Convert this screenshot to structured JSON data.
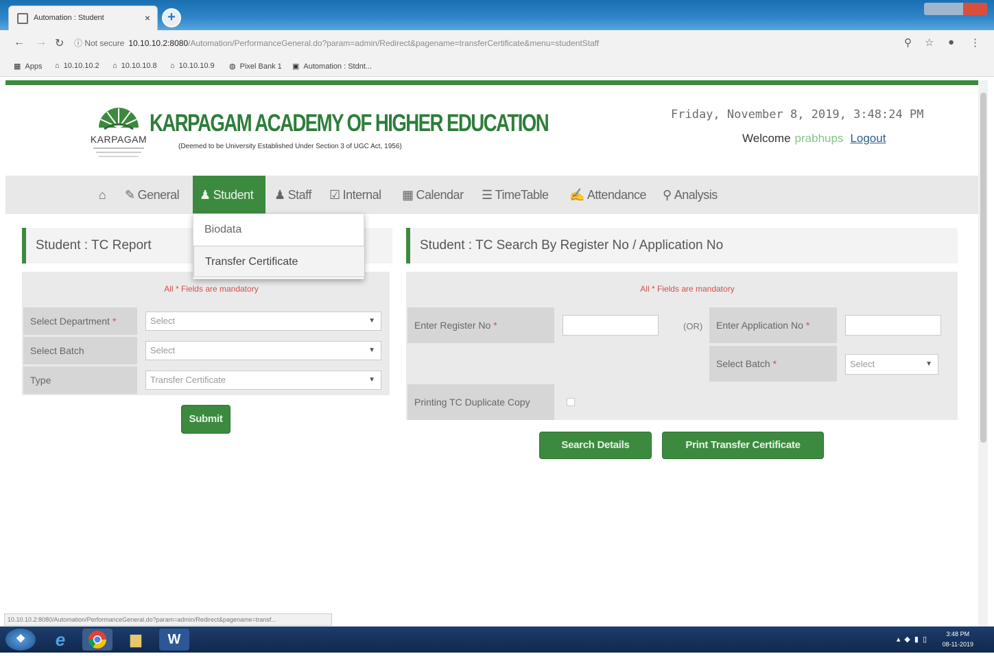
{
  "browser": {
    "tab_title": "Automation : Student",
    "tab_close": "×",
    "new_tab": "+",
    "not_secure": "ⓘ Not secure",
    "url_host": "10.10.10.2:8080",
    "url_path": "/Automation/PerformanceGeneral.do?param=admin/Redirect&pagename=transferCertificate&menu=studentStaff",
    "bookmarks": [
      {
        "icon": "apps-icon",
        "label": "Apps"
      },
      {
        "icon": "home-icon",
        "label": "10.10.10.2"
      },
      {
        "icon": "home-icon",
        "label": "10.10.10.8"
      },
      {
        "icon": "home-icon",
        "label": "10.10.10.9"
      },
      {
        "icon": "globe-icon",
        "label": "Pixel Bank 1"
      },
      {
        "icon": "page-icon",
        "label": "Automation : Stdnt..."
      }
    ]
  },
  "header": {
    "brand": "KARPAGAM ACADEMY OF HIGHER EDUCATION",
    "brand_sub": "(Deemed to be University Established Under Section 3 of UGC Act, 1956)",
    "logo_text": "KARPAGAM",
    "datetime": "Friday, November 8, 2019, 3:48:24 PM",
    "welcome": "Welcome",
    "username": "prabhups",
    "logout": "Logout"
  },
  "nav": {
    "items": [
      {
        "icon": "⌂",
        "label": ""
      },
      {
        "icon": "✎",
        "label": "General"
      },
      {
        "icon": "👤",
        "label": "Student"
      },
      {
        "icon": "♟",
        "label": "Staff"
      },
      {
        "icon": "☑",
        "label": "Internal"
      },
      {
        "icon": "▦",
        "label": "Calendar"
      },
      {
        "icon": "☰",
        "label": "TimeTable"
      },
      {
        "icon": "✍",
        "label": "Attendance"
      },
      {
        "icon": "⚲",
        "label": "Analysis"
      }
    ],
    "dropdown": [
      "Biodata",
      "Transfer Certificate"
    ]
  },
  "left_panel": {
    "title": "Student : TC Report",
    "mandatory": "All * Fields are mandatory",
    "rows": [
      {
        "label": "Select Department",
        "required": "*",
        "value": "Select"
      },
      {
        "label": "Select Batch",
        "required": "",
        "value": "Select"
      },
      {
        "label": "Type",
        "required": "",
        "value": "Transfer Certificate"
      }
    ],
    "submit": "Submit"
  },
  "right_panel": {
    "title": "Student : TC Search By Register No / Application No",
    "mandatory": "All * Fields are mandatory",
    "register_label": "Enter Register No",
    "or": "(OR)",
    "application_label": "Enter Application No",
    "batch_label": "Select Batch",
    "batch_value": "Select",
    "required": "*",
    "duplicate_label": "Printing TC Duplicate Copy",
    "search_button": "Search Details",
    "print_button": "Print Transfer Certificate"
  },
  "status_url": "10.10.10.2:8080/Automation/PerformanceGeneral.do?param=admin/Redirect&pagename=transf...",
  "taskbar": {
    "clock_time": "3:48 PM",
    "clock_date": "08-11-2019",
    "word_label": "W"
  },
  "colors": {
    "brand_green": "#3c8a3f",
    "title_blue": "#1a6fb3",
    "required_red": "#d0504a"
  }
}
